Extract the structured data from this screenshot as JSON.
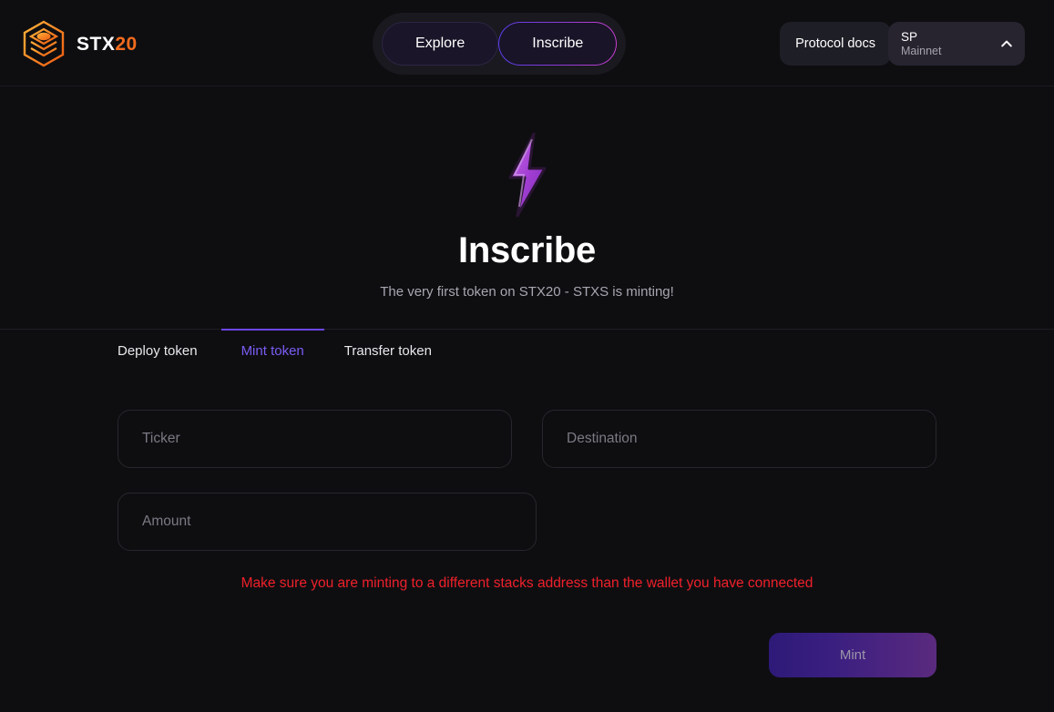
{
  "colors": {
    "page_bg": "#0e0e11",
    "accent_purple": "#6d45f0",
    "accent_orange": "#f26b1d",
    "warning_red": "#f0202a",
    "button_gradient_start": "#2e1a78",
    "button_gradient_end": "#5a2a7e"
  },
  "header": {
    "brand": {
      "name_white": "STX",
      "name_orange": "20",
      "logo_icon": "stacked-hexagon-layers-icon"
    },
    "nav": [
      {
        "label": "Explore",
        "active": false
      },
      {
        "label": "Inscribe",
        "active": true
      }
    ],
    "docs_button": "Protocol docs",
    "wallet": {
      "address": "SP",
      "network": "Mainnet",
      "chevron_icon": "chevron-up-icon"
    }
  },
  "hero": {
    "emoji": "high-voltage-bolt-icon",
    "title": "Inscribe",
    "subtitle": "The very first token on STX20 - STXS is minting!"
  },
  "tabs": [
    {
      "label": "Deploy token",
      "active": false
    },
    {
      "label": "Mint token",
      "active": true
    },
    {
      "label": "Transfer token",
      "active": false
    }
  ],
  "form": {
    "fields": [
      {
        "name": "ticker",
        "placeholder": "Ticker",
        "value": ""
      },
      {
        "name": "destination",
        "placeholder": "Destination",
        "value": ""
      },
      {
        "name": "amount",
        "placeholder": "Amount",
        "value": ""
      }
    ],
    "warning": "Make sure you are minting to a different stacks address than the wallet you have connected",
    "submit_label": "Mint"
  }
}
